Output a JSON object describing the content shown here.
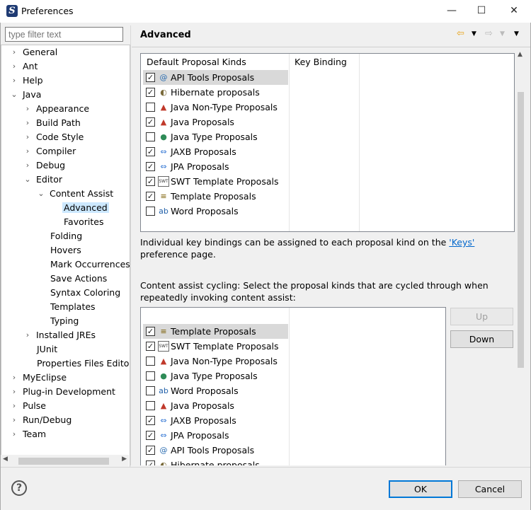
{
  "window": {
    "title": "Preferences",
    "minimize": "—",
    "maximize": "☐",
    "close": "✕"
  },
  "filter": {
    "placeholder": "type filter text"
  },
  "tree": {
    "general": "General",
    "ant": "Ant",
    "help": "Help",
    "java": "Java",
    "appearance": "Appearance",
    "build_path": "Build Path",
    "code_style": "Code Style",
    "compiler": "Compiler",
    "debug": "Debug",
    "editor": "Editor",
    "content_assist": "Content Assist",
    "advanced": "Advanced",
    "favorites": "Favorites",
    "folding": "Folding",
    "hovers": "Hovers",
    "mark_occurrences": "Mark Occurrences",
    "save_actions": "Save Actions",
    "syntax_coloring": "Syntax Coloring",
    "templates": "Templates",
    "typing": "Typing",
    "installed_jres": "Installed JREs",
    "junit": "JUnit",
    "properties_files_editor": "Properties Files Edito",
    "myeclipse": "MyEclipse",
    "plugin_development": "Plug-in Development",
    "pulse": "Pulse",
    "run_debug": "Run/Debug",
    "team": "Team"
  },
  "page": {
    "title": "Advanced"
  },
  "proposals_table": {
    "col_kinds": "Default Proposal Kinds",
    "col_binding": "Key Binding",
    "rows": [
      {
        "label": "API Tools Proposals",
        "checked": "✓",
        "icon": "@"
      },
      {
        "label": "Hibernate proposals",
        "checked": "✓",
        "icon": "◐"
      },
      {
        "label": "Java Non-Type Proposals",
        "checked": "",
        "icon": "▲"
      },
      {
        "label": "Java Proposals",
        "checked": "✓",
        "icon": "▲"
      },
      {
        "label": "Java Type Proposals",
        "checked": "",
        "icon": "●"
      },
      {
        "label": "JAXB Proposals",
        "checked": "✓",
        "icon": "⇔"
      },
      {
        "label": "JPA Proposals",
        "checked": "✓",
        "icon": "⇔"
      },
      {
        "label": "SWT Template Proposals",
        "checked": "✓",
        "icon": "SWT"
      },
      {
        "label": "Template Proposals",
        "checked": "✓",
        "icon": "≡"
      },
      {
        "label": "Word Proposals",
        "checked": "",
        "icon": "ab"
      }
    ]
  },
  "info": {
    "text_before": "Individual key bindings can be assigned to each proposal kind on the ",
    "link": "'Keys'",
    "text_after": " preference page."
  },
  "cycling": {
    "description": "Content assist cycling: Select the proposal kinds that are cycled through when repeatedly invoking content assist:",
    "rows": [
      {
        "label": "Template Proposals",
        "checked": "✓",
        "icon": "≡"
      },
      {
        "label": "SWT Template Proposals",
        "checked": "✓",
        "icon": "SWT"
      },
      {
        "label": "Java Non-Type Proposals",
        "checked": "",
        "icon": "▲"
      },
      {
        "label": "Java Type Proposals",
        "checked": "",
        "icon": "●"
      },
      {
        "label": "Word Proposals",
        "checked": "",
        "icon": "ab"
      },
      {
        "label": "Java Proposals",
        "checked": "",
        "icon": "▲"
      },
      {
        "label": "JAXB Proposals",
        "checked": "✓",
        "icon": "⇔"
      },
      {
        "label": "JPA Proposals",
        "checked": "✓",
        "icon": "⇔"
      },
      {
        "label": "API Tools Proposals",
        "checked": "✓",
        "icon": "@"
      },
      {
        "label": "Hibernate proposals",
        "checked": "✓",
        "icon": "◐"
      }
    ],
    "up": "Up",
    "down": "Down"
  },
  "buttons": {
    "ok": "OK",
    "cancel": "Cancel",
    "help": "?"
  },
  "colors": {
    "selection": "#cce8ff",
    "accent": "#0078d7",
    "link": "#0066cc",
    "back_arrow": "#e8a317"
  }
}
